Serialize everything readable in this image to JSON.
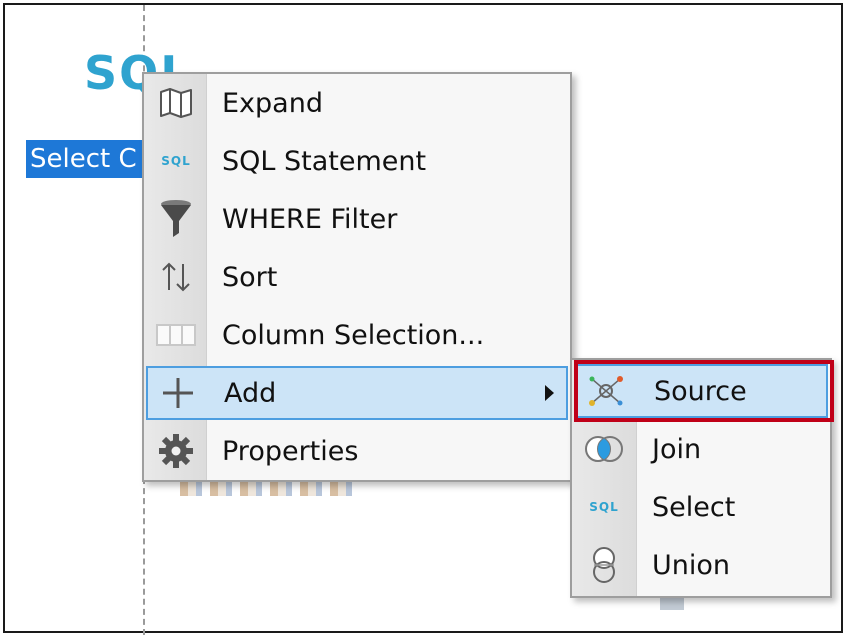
{
  "canvas": {
    "node_logo_text": "SQL",
    "node_label": "Select C"
  },
  "context_menu": {
    "items": [
      {
        "label": "Expand",
        "icon": "map-icon"
      },
      {
        "label": "SQL Statement",
        "icon": "sql-icon",
        "icon_text": "SQL"
      },
      {
        "label": "WHERE Filter",
        "icon": "funnel-icon"
      },
      {
        "label": "Sort",
        "icon": "sort-arrows-icon"
      },
      {
        "label": "Column Selection...",
        "icon": "columns-icon"
      },
      {
        "label": "Add",
        "icon": "plus-icon",
        "highlighted": true,
        "has_submenu": true
      },
      {
        "label": "Properties",
        "icon": "gear-icon"
      }
    ]
  },
  "submenu": {
    "items": [
      {
        "label": "Source",
        "icon": "source-icon",
        "highlighted": true
      },
      {
        "label": "Join",
        "icon": "join-icon"
      },
      {
        "label": "Select",
        "icon": "sql-icon",
        "icon_text": "SQL"
      },
      {
        "label": "Union",
        "icon": "union-icon"
      }
    ]
  },
  "colors": {
    "selection_blue": "#1e78d7",
    "menu_highlight": "#cce4f7",
    "menu_highlight_border": "#4d9ee0",
    "annotation_red": "#c00018",
    "sql_blue": "#2fa3cf"
  }
}
